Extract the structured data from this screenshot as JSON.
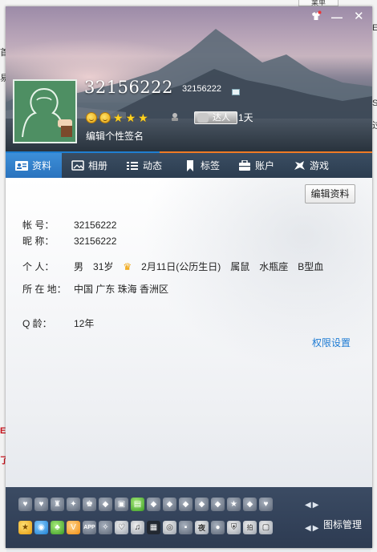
{
  "desktop": {
    "tab_label": "業单",
    "left_fragments": [
      "首",
      "易",
      "E",
      "了"
    ],
    "right_fragments": [
      "E",
      "S",
      "过"
    ]
  },
  "window": {
    "controls": {
      "skin": "skin-icon",
      "minimize": "—",
      "close": "✕"
    }
  },
  "profile": {
    "uid_large": "32156222",
    "uid_small": "32156222",
    "talent_label": "达人",
    "days": "1天",
    "signature_placeholder": "编辑个性签名",
    "level_icons": [
      "sun",
      "sun",
      "star",
      "star",
      "star"
    ]
  },
  "tabs": [
    {
      "label": "资料",
      "icon": "profile-card-icon",
      "active": true
    },
    {
      "label": "相册",
      "icon": "photo-album-icon",
      "active": false
    },
    {
      "label": "动态",
      "icon": "feed-list-icon",
      "active": false
    },
    {
      "label": "标签",
      "icon": "bookmark-icon",
      "active": false
    },
    {
      "label": "账户",
      "icon": "wallet-icon",
      "active": false
    },
    {
      "label": "游戏",
      "icon": "game-icon",
      "active": false
    }
  ],
  "details": {
    "edit_button": "编辑资料",
    "account": {
      "label": "帐    号：",
      "value": "32156222"
    },
    "nickname": {
      "label": "昵    称：",
      "value": "32156222"
    },
    "personal": {
      "label": "个    人：",
      "gender": "男",
      "age": "31岁",
      "birthday": "2月11日(公历生日)",
      "zodiac": "属鼠",
      "constellation": "水瓶座",
      "blood": "B型血"
    },
    "location": {
      "label": "所 在 地：",
      "value": "中国 广东 珠海 香洲区"
    },
    "q_age": {
      "label": "Q    龄：",
      "value": "12年"
    },
    "permission_link": "权限设置"
  },
  "iconbar": {
    "manage_label": "图标管理",
    "row2_text": {
      "app": "APP",
      "night": "夜",
      "num": "拍"
    }
  },
  "colors": {
    "accent_blue": "#2a73be",
    "accent_orange": "#f07a24",
    "tabbar": "#2c3d50",
    "link": "#1d7bd3"
  }
}
